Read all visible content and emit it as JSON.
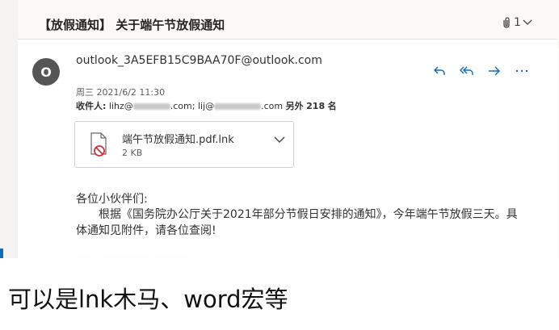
{
  "email": {
    "subject": "【放假通知】 关于端午节放假通知",
    "attachment_count": "1",
    "sender_initial": "O",
    "sender": "outlook_3A5EFB15C9BAA70F@outlook.com",
    "date": "周三 2021/6/2 11:30",
    "recipients_label": "收件人:",
    "recipient_1_prefix": "lihz@",
    "recipient_1_suffix": ".com;",
    "recipient_2_prefix": "lij@",
    "recipient_2_suffix": ".com",
    "others_label": "另外",
    "others_count": "218",
    "others_unit": "名",
    "actions": {
      "reply": "reply-icon",
      "reply_all": "reply-all-icon",
      "forward": "forward-icon",
      "more": "more-icon"
    }
  },
  "attachment": {
    "name": "端午节放假通知.pdf.lnk",
    "size": "2 KB"
  },
  "body": {
    "greeting": "各位小伙伴们:",
    "paragraph": "根据《国务院办公厅关于2021年部分节假日安排的通知》，今年端午节放假三天。具体通知见附件，请各位查阅!"
  },
  "caption": "可以是lnk木马、word宏等",
  "colors": {
    "accent": "#0f6cbd",
    "avatar": "#555555"
  }
}
